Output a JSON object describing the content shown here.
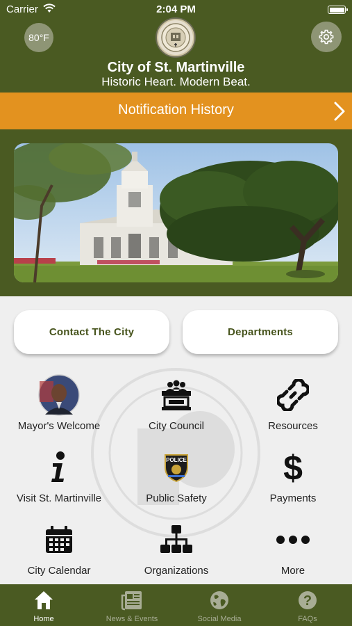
{
  "status_bar": {
    "carrier": "Carrier",
    "time": "2:04 PM"
  },
  "header": {
    "temperature": "80°F",
    "city_name": "City of St. Martinville",
    "tagline": "Historic Heart. Modern Beat."
  },
  "notification": {
    "label": "Notification History"
  },
  "quick_actions": {
    "contact": "Contact The City",
    "departments": "Departments"
  },
  "grid": [
    {
      "label": "Mayor's Welcome",
      "icon": "mayor-photo"
    },
    {
      "label": "City Council",
      "icon": "city-council-icon"
    },
    {
      "label": "Resources",
      "icon": "link-icon"
    },
    {
      "label": "Visit St. Martinville",
      "icon": "info-icon"
    },
    {
      "label": "Public Safety",
      "icon": "police-badge-icon"
    },
    {
      "label": "Payments",
      "icon": "dollar-icon"
    },
    {
      "label": "City Calendar",
      "icon": "calendar-icon"
    },
    {
      "label": "Organizations",
      "icon": "org-chart-icon"
    },
    {
      "label": "More",
      "icon": "more-icon"
    }
  ],
  "tabs": [
    {
      "label": "Home",
      "icon": "home-icon",
      "active": true
    },
    {
      "label": "News & Events",
      "icon": "newspaper-icon",
      "active": false
    },
    {
      "label": "Social Media",
      "icon": "globe-icon",
      "active": false
    },
    {
      "label": "FAQs",
      "icon": "question-icon",
      "active": false
    }
  ],
  "colors": {
    "header": "#4a5a22",
    "banner": "#e3921f",
    "button_text": "#47541d"
  }
}
